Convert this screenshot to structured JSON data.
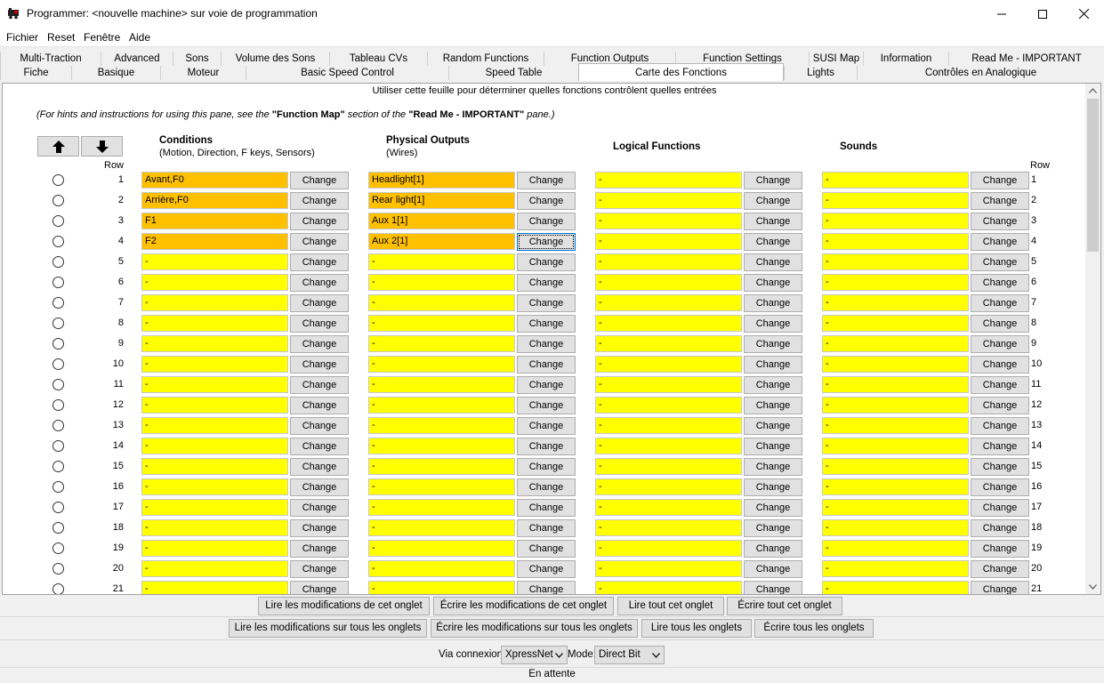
{
  "window": {
    "title": "Programmer: <nouvelle machine> sur voie de programmation",
    "controls": [
      "minimize",
      "maximize",
      "close"
    ]
  },
  "menu": [
    "Fichier",
    "Reset",
    "Fenêtre",
    "Aide"
  ],
  "tabs_row1": [
    "Multi-Traction",
    "Advanced",
    "Sons",
    "Volume des Sons",
    "Tableau CVs",
    "Random Functions",
    "Function Outputs",
    "Function Settings",
    "SUSI Map",
    "Information",
    "Read Me - IMPORTANT"
  ],
  "tabs_row2": [
    "Fiche",
    "Basique",
    "Moteur",
    "Basic Speed Control",
    "Speed Table",
    "Carte des Fonctions",
    "Lights",
    "Contrôles en Analogique"
  ],
  "active_tab": "Carte des Fonctions",
  "pane": {
    "instruction": "Utiliser cette feuille pour déterminer quelles fonctions contrôlent quelles entrées",
    "hint_before": "(For hints and instructions for using this pane, see the ",
    "hint_b1": "\"Function Map\"",
    "hint_mid": " section of the ",
    "hint_b2": "\"Read Me - IMPORTANT\"",
    "hint_after": " pane.)",
    "row_label": "Row",
    "columns": {
      "conditions": {
        "title": "Conditions",
        "subtitle": "(Motion, Direction, F keys, Sensors)"
      },
      "physical": {
        "title": "Physical Outputs",
        "subtitle": "(Wires)"
      },
      "logical": {
        "title": "Logical Functions"
      },
      "sounds": {
        "title": "Sounds"
      }
    },
    "change_label": "Change",
    "colors": {
      "set": "#ffc000",
      "empty": "#ffff00"
    },
    "rows": [
      {
        "n": "1",
        "conditions": "Avant,F0",
        "physical": "Headlight[1]",
        "logical": "-",
        "sounds": "-"
      },
      {
        "n": "2",
        "conditions": "Arrière,F0",
        "physical": "Rear light[1]",
        "logical": "-",
        "sounds": "-"
      },
      {
        "n": "3",
        "conditions": "F1",
        "physical": "Aux 1[1]",
        "logical": "-",
        "sounds": "-"
      },
      {
        "n": "4",
        "conditions": "F2",
        "physical": "Aux 2[1]",
        "logical": "-",
        "sounds": "-"
      },
      {
        "n": "5",
        "conditions": "-",
        "physical": "-",
        "logical": "-",
        "sounds": "-"
      },
      {
        "n": "6",
        "conditions": "-",
        "physical": "-",
        "logical": "-",
        "sounds": "-"
      },
      {
        "n": "7",
        "conditions": "-",
        "physical": "-",
        "logical": "-",
        "sounds": "-"
      },
      {
        "n": "8",
        "conditions": "-",
        "physical": "-",
        "logical": "-",
        "sounds": "-"
      },
      {
        "n": "9",
        "conditions": "-",
        "physical": "-",
        "logical": "-",
        "sounds": "-"
      },
      {
        "n": "10",
        "conditions": "-",
        "physical": "-",
        "logical": "-",
        "sounds": "-"
      },
      {
        "n": "11",
        "conditions": "-",
        "physical": "-",
        "logical": "-",
        "sounds": "-"
      },
      {
        "n": "12",
        "conditions": "-",
        "physical": "-",
        "logical": "-",
        "sounds": "-"
      },
      {
        "n": "13",
        "conditions": "-",
        "physical": "-",
        "logical": "-",
        "sounds": "-"
      },
      {
        "n": "14",
        "conditions": "-",
        "physical": "-",
        "logical": "-",
        "sounds": "-"
      },
      {
        "n": "15",
        "conditions": "-",
        "physical": "-",
        "logical": "-",
        "sounds": "-"
      },
      {
        "n": "16",
        "conditions": "-",
        "physical": "-",
        "logical": "-",
        "sounds": "-"
      },
      {
        "n": "17",
        "conditions": "-",
        "physical": "-",
        "logical": "-",
        "sounds": "-"
      },
      {
        "n": "18",
        "conditions": "-",
        "physical": "-",
        "logical": "-",
        "sounds": "-"
      },
      {
        "n": "19",
        "conditions": "-",
        "physical": "-",
        "logical": "-",
        "sounds": "-"
      },
      {
        "n": "20",
        "conditions": "-",
        "physical": "-",
        "logical": "-",
        "sounds": "-"
      },
      {
        "n": "21",
        "conditions": "-",
        "physical": "-",
        "logical": "-",
        "sounds": "-"
      }
    ]
  },
  "buttons_tab": [
    "Lire les modifications de cet onglet",
    "Écrire les modifications de cet onglet",
    "Lire tout cet onglet",
    "Écrire tout cet onglet"
  ],
  "buttons_all": [
    "Lire les modifications sur tous les onglets",
    "Écrire les modifications sur tous les onglets",
    "Lire tous les onglets",
    "Écrire tous les onglets"
  ],
  "connection": {
    "via_label": "Via connexion:",
    "via_value": "XpressNet",
    "mode_label": "Mode:",
    "mode_value": "Direct Bit"
  },
  "status": "En attente"
}
